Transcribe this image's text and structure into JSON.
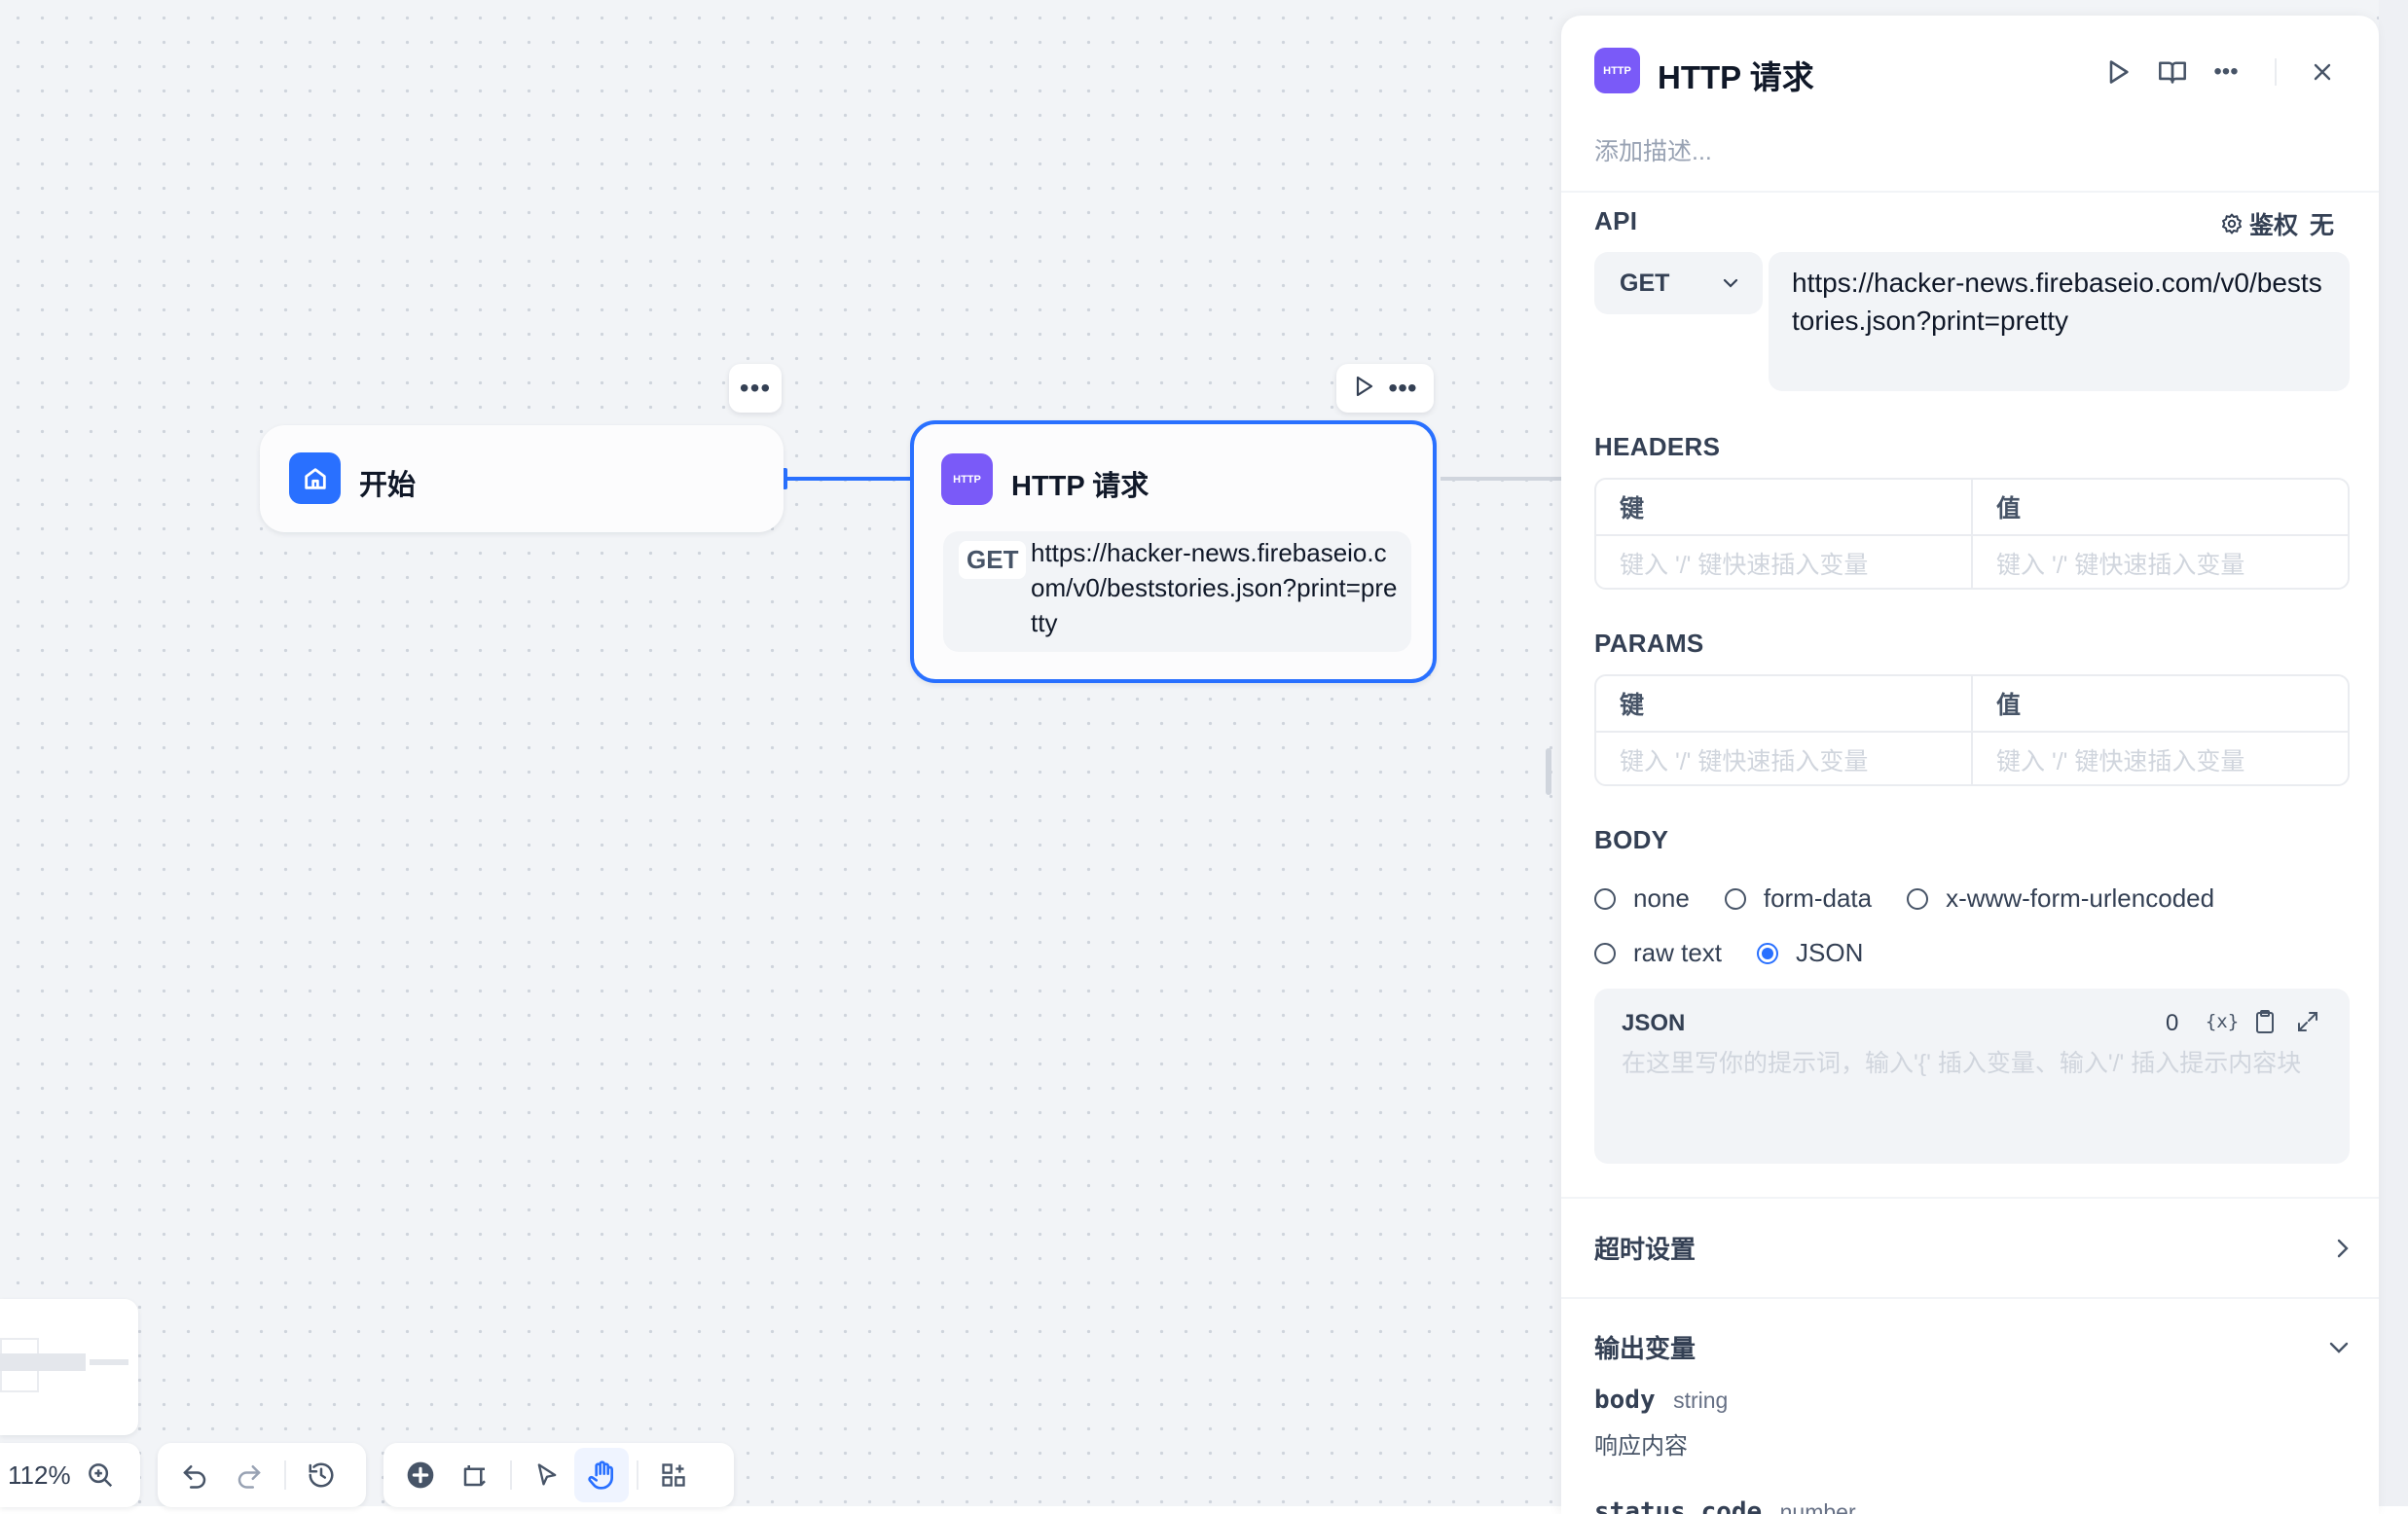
{
  "canvas": {
    "start_node": {
      "title": "开始"
    },
    "http_node": {
      "icon_text": "HTTP",
      "title": "HTTP 请求",
      "method": "GET",
      "url": "https://hacker-news.firebaseio.com/v0/beststories.json?print=pretty"
    },
    "toolbar": {
      "zoom": "112%"
    }
  },
  "panel": {
    "icon_text": "HTTP",
    "title": "HTTP 请求",
    "description_placeholder": "添加描述...",
    "api": {
      "label": "API",
      "auth_label": "鉴权",
      "auth_value": "无",
      "method": "GET",
      "url": "https://hacker-news.firebaseio.com/v0/beststories.json?print=pretty"
    },
    "headers": {
      "label": "HEADERS",
      "key_header": "键",
      "value_header": "值",
      "key_placeholder": "键入 '/' 键快速插入变量",
      "value_placeholder": "键入 '/' 键快速插入变量"
    },
    "params": {
      "label": "PARAMS",
      "key_header": "键",
      "value_header": "值",
      "key_placeholder": "键入 '/' 键快速插入变量",
      "value_placeholder": "键入 '/' 键快速插入变量"
    },
    "body": {
      "label": "BODY",
      "options": [
        "none",
        "form-data",
        "x-www-form-urlencoded",
        "raw text",
        "JSON"
      ],
      "selected": "JSON",
      "json_label": "JSON",
      "json_count": "0",
      "json_placeholder": "在这里写你的提示词，输入'{' 插入变量、输入'/' 插入提示内容块"
    },
    "timeout": {
      "label": "超时设置"
    },
    "outputs": {
      "label": "输出变量",
      "vars": [
        {
          "name": "body",
          "type": "string",
          "desc": "响应内容"
        },
        {
          "name": "status_code",
          "type": "number"
        }
      ]
    }
  },
  "colors": {
    "accent": "#2970ff",
    "http_icon": "#7a5af8",
    "start_icon": "#2970ff"
  }
}
